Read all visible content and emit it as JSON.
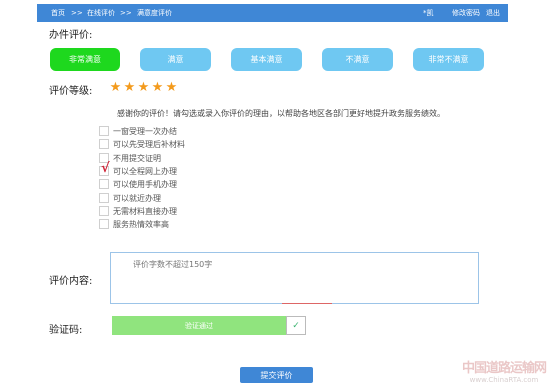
{
  "breadcrumb": {
    "home": "首页",
    "sep1": ">>",
    "online_review": "在线评价",
    "sep2": ">>",
    "current": "满意度评价"
  },
  "header": {
    "user": "*凯",
    "change_password": "修改密码",
    "logout": "退出"
  },
  "rating": {
    "label": "办件评价:",
    "options": [
      "非常满意",
      "满意",
      "基本满意",
      "不满意",
      "非常不满意"
    ],
    "selected": "非常满意",
    "active_color": "#1ed81e",
    "inactive_color": "#6fc8f2"
  },
  "level": {
    "label": "评价等级:",
    "stars": [
      "★",
      "★",
      "★",
      "★",
      "★"
    ],
    "value": 5,
    "max": 5,
    "star_color": "#f39a1c"
  },
  "hint": "感谢你的评价！请勾选或录入你评价的理由，以帮助各地区各部门更好地提升政务服务绩效。",
  "reasons": [
    {
      "label": "一窗受理一次办结",
      "checked": false,
      "mark": ""
    },
    {
      "label": "可以先受理后补材料",
      "checked": false,
      "mark": ""
    },
    {
      "label": "不用提交证明",
      "checked": false,
      "mark": ""
    },
    {
      "label": "可以全程网上办理",
      "checked": true,
      "mark": "√"
    },
    {
      "label": "可以使用手机办理",
      "checked": false,
      "mark": ""
    },
    {
      "label": "可以就近办理",
      "checked": false,
      "mark": ""
    },
    {
      "label": "无需材料直接办理",
      "checked": false,
      "mark": ""
    },
    {
      "label": "服务热情效率高",
      "checked": false,
      "mark": ""
    }
  ],
  "content": {
    "label": "评价内容:",
    "placeholder": "评价字数不超过150字",
    "value": ""
  },
  "captcha": {
    "label": "验证码:",
    "status": "验证通过",
    "check": "✓",
    "success_color": "#90e47e"
  },
  "submit": "提交评价",
  "watermark": {
    "line1": "中国道路运输网",
    "line2": "www.ChinaRTA.com"
  },
  "theme": {
    "primary": "#3f87d6"
  }
}
